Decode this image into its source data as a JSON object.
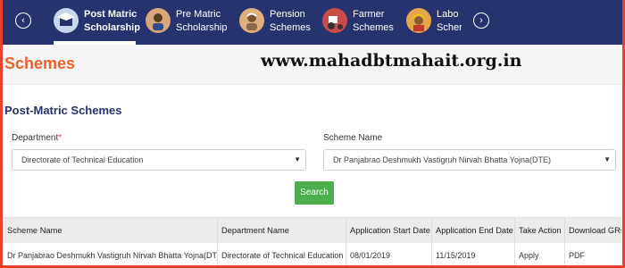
{
  "nav": {
    "items": [
      {
        "label_line1": "Post Matric",
        "label_line2": "Scholarship",
        "icon": "graduation-cap-icon",
        "color": "#c9d6f0"
      },
      {
        "label_line1": "Pre Matric",
        "label_line2": "Scholarship",
        "icon": "student-icon",
        "color": "#d9a57a"
      },
      {
        "label_line1": "Pension",
        "label_line2": "Schemes",
        "icon": "elderly-person-icon",
        "color": "#e0b07c"
      },
      {
        "label_line1": "Farmer",
        "label_line2": "Schemes",
        "icon": "tractor-icon",
        "color": "#d9534f"
      },
      {
        "label_line1": "Labo",
        "label_line2": "Scher",
        "icon": "worker-icon",
        "color": "#e8a64a"
      }
    ]
  },
  "page": {
    "schemes_title": "Schemes",
    "watermark": "www.mahadbtmahait.org.in",
    "section_title": "Post-Matric Schemes"
  },
  "form": {
    "department_label": "Department",
    "department_required": "*",
    "department_value": "Directorate of Technical Education",
    "scheme_label": "Scheme Name",
    "scheme_value": "Dr Panjabrao Deshmukh Vastigruh Nirvah Bhatta Yojna(DTE)",
    "search_label": "Search"
  },
  "table": {
    "headers": [
      "Scheme Name",
      "Department Name",
      "Application Start Date",
      "Application End Date",
      "Take Action",
      "Download GRs"
    ],
    "rows": [
      [
        "Dr Panjabrao Deshmukh Vastigruh Nirvah Bhatta Yojna(DTE)",
        "Directorate of Technical Education",
        "08/01/2019",
        "11/15/2019",
        "Apply",
        "PDF"
      ]
    ]
  },
  "colors": {
    "nav_bg": "#27336e",
    "accent_orange": "#e8632c",
    "search_green": "#4cae4c",
    "frame_red": "#e8412c"
  }
}
